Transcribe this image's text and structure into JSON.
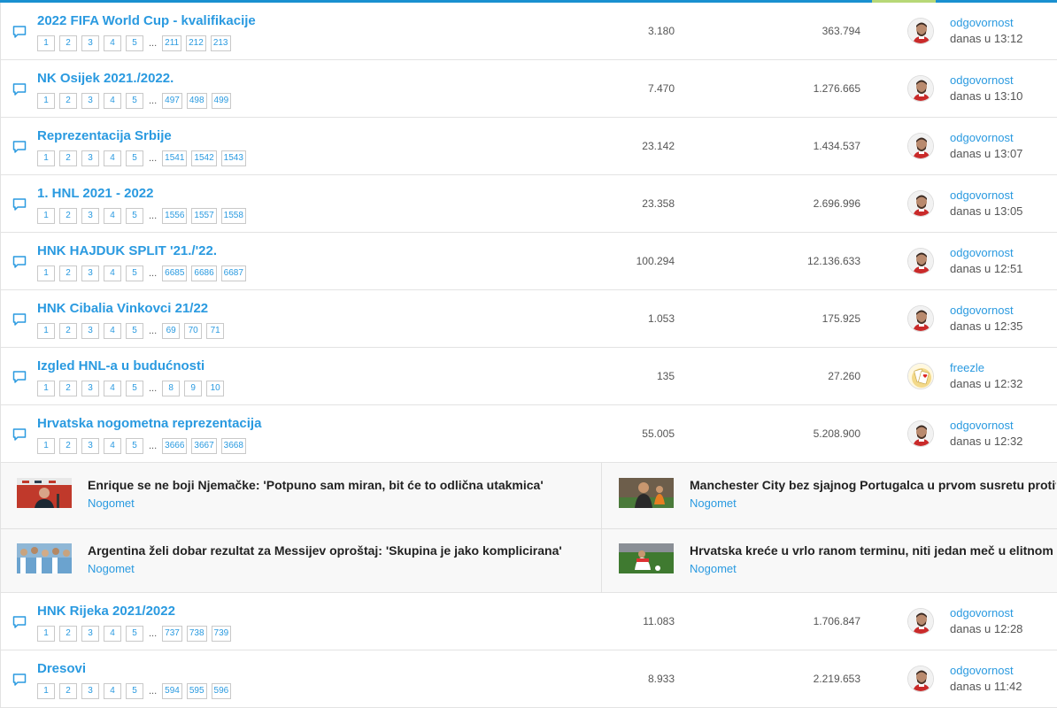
{
  "topics_top": [
    {
      "title": "2022 FIFA World Cup - kvalifikacije",
      "pages": [
        "1",
        "2",
        "3",
        "4",
        "5"
      ],
      "last_pages": [
        "211",
        "212",
        "213"
      ],
      "replies": "3.180",
      "views": "363.794",
      "user": "odgovornost",
      "time": "danas u 13:12",
      "avatar": "player"
    },
    {
      "title": "NK Osijek 2021./2022.",
      "pages": [
        "1",
        "2",
        "3",
        "4",
        "5"
      ],
      "last_pages": [
        "497",
        "498",
        "499"
      ],
      "replies": "7.470",
      "views": "1.276.665",
      "user": "odgovornost",
      "time": "danas u 13:10",
      "avatar": "player"
    },
    {
      "title": "Reprezentacija Srbije",
      "pages": [
        "1",
        "2",
        "3",
        "4",
        "5"
      ],
      "last_pages": [
        "1541",
        "1542",
        "1543"
      ],
      "replies": "23.142",
      "views": "1.434.537",
      "user": "odgovornost",
      "time": "danas u 13:07",
      "avatar": "player"
    },
    {
      "title": "1. HNL 2021 - 2022",
      "pages": [
        "1",
        "2",
        "3",
        "4",
        "5"
      ],
      "last_pages": [
        "1556",
        "1557",
        "1558"
      ],
      "replies": "23.358",
      "views": "2.696.996",
      "user": "odgovornost",
      "time": "danas u 13:05",
      "avatar": "player"
    },
    {
      "title": "HNK HAJDUK SPLIT '21./'22.",
      "pages": [
        "1",
        "2",
        "3",
        "4",
        "5"
      ],
      "last_pages": [
        "6685",
        "6686",
        "6687"
      ],
      "replies": "100.294",
      "views": "12.136.633",
      "user": "odgovornost",
      "time": "danas u 12:51",
      "avatar": "player"
    },
    {
      "title": "HNK Cibalia Vinkovci 21/22",
      "pages": [
        "1",
        "2",
        "3",
        "4",
        "5"
      ],
      "last_pages": [
        "69",
        "70",
        "71"
      ],
      "replies": "1.053",
      "views": "175.925",
      "user": "odgovornost",
      "time": "danas u 12:35",
      "avatar": "player"
    },
    {
      "title": "Izgled HNL-a u budućnosti",
      "pages": [
        "1",
        "2",
        "3",
        "4",
        "5"
      ],
      "last_pages": [
        "8",
        "9",
        "10"
      ],
      "replies": "135",
      "views": "27.260",
      "user": "freezle",
      "time": "danas u 12:32",
      "avatar": "cards"
    },
    {
      "title": "Hrvatska nogometna reprezentacija",
      "pages": [
        "1",
        "2",
        "3",
        "4",
        "5"
      ],
      "last_pages": [
        "3666",
        "3667",
        "3668"
      ],
      "replies": "55.005",
      "views": "5.208.900",
      "user": "odgovornost",
      "time": "danas u 12:32",
      "avatar": "player"
    }
  ],
  "topics_bottom": [
    {
      "title": "HNK Rijeka 2021/2022",
      "pages": [
        "1",
        "2",
        "3",
        "4",
        "5"
      ],
      "last_pages": [
        "737",
        "738",
        "739"
      ],
      "replies": "11.083",
      "views": "1.706.847",
      "user": "odgovornost",
      "time": "danas u 12:28",
      "avatar": "player"
    },
    {
      "title": "Dresovi",
      "pages": [
        "1",
        "2",
        "3",
        "4",
        "5"
      ],
      "last_pages": [
        "594",
        "595",
        "596"
      ],
      "replies": "8.933",
      "views": "2.219.653",
      "user": "odgovornost",
      "time": "danas u 11:42",
      "avatar": "player"
    }
  ],
  "ellipsis": "...",
  "news": [
    {
      "title": "Enrique se ne boji Njemačke: 'Potpuno sam miran, bit će to odlična utakmica'",
      "category": "Nogomet",
      "thumb": "press"
    },
    {
      "title": "Manchester City bez sjajnog Portugalca u prvom susretu protiv",
      "category": "Nogomet",
      "thumb": "coach"
    },
    {
      "title": "Argentina želi dobar rezultat za Messijev oproštaj: 'Skupina je jako komplicirana'",
      "category": "Nogomet",
      "thumb": "crowd"
    },
    {
      "title": "Hrvatska kreće u vrlo ranom terminu, niti jedan meč u elitnom",
      "category": "Nogomet",
      "thumb": "pitch"
    }
  ],
  "colors": {
    "accent": "#2a9ae0",
    "top_bar": "#1a90d0"
  }
}
